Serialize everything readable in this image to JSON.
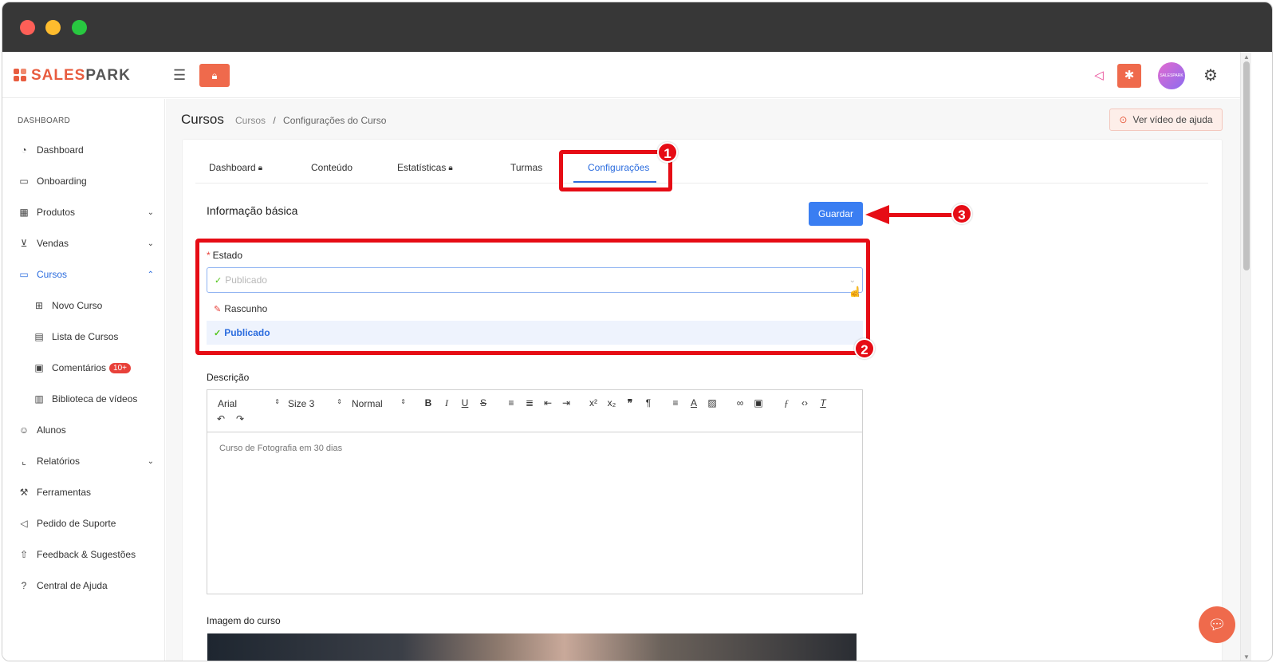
{
  "app": {
    "logo_prefix": "SALES",
    "logo_suffix": "PARK"
  },
  "topbar": {
    "menu_icon": "menu-fold-icon",
    "lock_icon": "lock-icon",
    "announce_icon": "megaphone-icon",
    "bug_icon": "bug-icon",
    "avatar_text": "SALESPARK",
    "settings_icon": "gear-icon"
  },
  "sidebar": {
    "section": "DASHBOARD",
    "items": [
      {
        "label": "Dashboard",
        "icon": "dashboard-icon"
      },
      {
        "label": "Onboarding",
        "icon": "video-icon"
      },
      {
        "label": "Produtos",
        "icon": "grid-icon"
      },
      {
        "label": "Vendas",
        "icon": "cart-icon"
      },
      {
        "label": "Cursos",
        "icon": "monitor-icon"
      },
      {
        "label": "Novo Curso",
        "icon": "file-add-icon"
      },
      {
        "label": "Lista de Cursos",
        "icon": "table-icon"
      },
      {
        "label": "Comentários",
        "icon": "comment-file-icon",
        "badge": "10+"
      },
      {
        "label": "Biblioteca de vídeos",
        "icon": "book-icon"
      },
      {
        "label": "Alunos",
        "icon": "user-icon"
      },
      {
        "label": "Relatórios",
        "icon": "chart-icon"
      },
      {
        "label": "Ferramentas",
        "icon": "tool-icon"
      },
      {
        "label": "Pedido de Suporte",
        "icon": "megaphone-icon"
      },
      {
        "label": "Feedback & Sugestões",
        "icon": "rocket-icon"
      },
      {
        "label": "Central de Ajuda",
        "icon": "question-icon"
      }
    ]
  },
  "header": {
    "title": "Cursos",
    "breadcrumb": [
      "Cursos",
      "Configurações do Curso"
    ],
    "breadcrumb_sep": "/",
    "help_button": "Ver vídeo de ajuda"
  },
  "tabs": [
    {
      "label": "Dashboard",
      "locked": true
    },
    {
      "label": "Conteúdo",
      "locked": false
    },
    {
      "label": "Estatísticas",
      "locked": true
    },
    {
      "label": "Turmas",
      "locked": false
    },
    {
      "label": "Configurações",
      "locked": false,
      "active": true
    }
  ],
  "form": {
    "section_title": "Informação básica",
    "save_label": "Guardar",
    "status_label": "Estado",
    "status_required": "*",
    "status_placeholder": "Publicado",
    "status_options": [
      {
        "label": "Rascunho",
        "icon": "edit-icon"
      },
      {
        "label": "Publicado",
        "icon": "check-circle-icon",
        "selected": true
      }
    ],
    "description_label": "Descrição",
    "editor": {
      "font": "Arial",
      "size": "Size 3",
      "format": "Normal",
      "content": "Curso de Fotografia em 30 dias"
    },
    "image_label": "Imagem do curso"
  },
  "annotations": [
    "1",
    "2",
    "3"
  ],
  "colors": {
    "accent": "#2b6cde",
    "brand": "#ef6a4c",
    "annotation": "#e60c15",
    "save": "#3a7ef2"
  }
}
